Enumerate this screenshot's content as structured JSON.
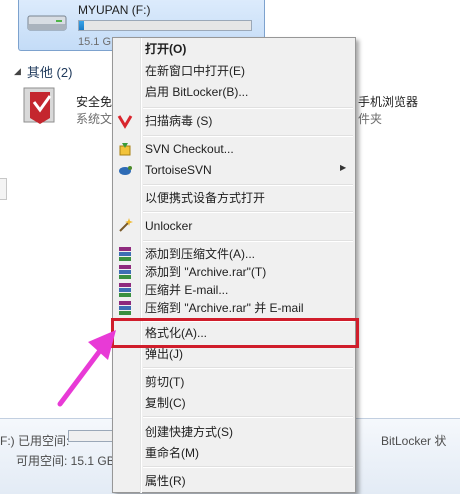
{
  "drive": {
    "name": "MYUPAN (F:)",
    "free_text": "15.1 G",
    "used_fraction": 0.03
  },
  "group": {
    "label": "其他 (2)"
  },
  "items": [
    {
      "name": "安全免",
      "sub": "系统文"
    },
    {
      "name": "手机浏览器",
      "sub": "件夹"
    }
  ],
  "details": {
    "used_label": "F:) 已用空间:",
    "free_label": "可用空间: 15.1 GB",
    "bitlocker_label": "BitLocker 状"
  },
  "menu": {
    "items": [
      {
        "label": "打开(O)",
        "bold": true
      },
      {
        "label": "在新窗口中打开(E)"
      },
      {
        "label": "启用 BitLocker(B)..."
      },
      {
        "label": "扫描病毒 (S)",
        "icon": "antivirus-icon"
      },
      {
        "label": "SVN Checkout...",
        "icon": "svn-checkout-icon"
      },
      {
        "label": "TortoiseSVN",
        "icon": "tortoisesvn-icon",
        "submenu": true
      },
      {
        "label": "以便携式设备方式打开"
      },
      {
        "label": "Unlocker",
        "icon": "unlocker-wand-icon"
      },
      {
        "label": "添加到压缩文件(A)...",
        "icon": "winrar-icon"
      },
      {
        "label": "添加到 \"Archive.rar\"(T)",
        "icon": "winrar-icon"
      },
      {
        "label": "压缩并 E-mail...",
        "icon": "winrar-icon"
      },
      {
        "label": "压缩到 \"Archive.rar\" 并 E-mail",
        "icon": "winrar-icon"
      },
      {
        "label": "格式化(A)...",
        "highlighted": true
      },
      {
        "label": "弹出(J)"
      },
      {
        "label": "剪切(T)"
      },
      {
        "label": "复制(C)"
      },
      {
        "label": "创建快捷方式(S)"
      },
      {
        "label": "重命名(M)"
      },
      {
        "label": "属性(R)"
      }
    ]
  },
  "colors": {
    "highlight_border": "#d01d2b",
    "annotation_arrow": "#e83ad6"
  }
}
